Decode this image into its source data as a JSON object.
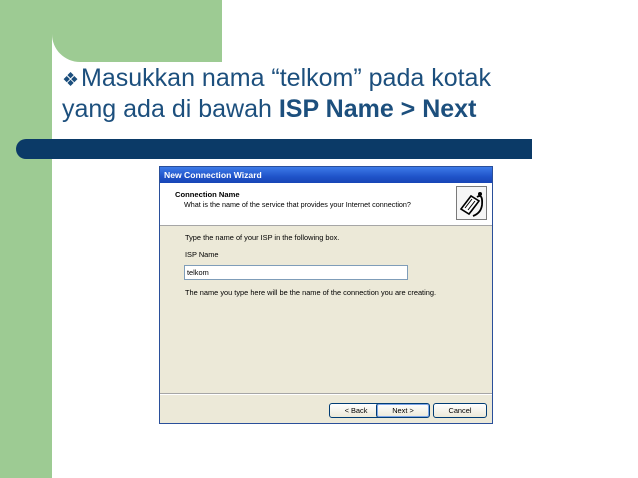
{
  "slide": {
    "bullet_icon": "diamond-bullet",
    "line1": "Masukkan nama “telkom” pada kotak",
    "line2_prefix": "yang ada di bawah ",
    "line2_bold": "ISP Name > Next",
    "colors": {
      "green": "#9dcb93",
      "navy": "#0b3a67",
      "text": "#1c4f7d"
    }
  },
  "dialog": {
    "title": "New Connection Wizard",
    "header_title": "Connection Name",
    "header_subtitle": "What is the name of the service that provides your Internet connection?",
    "header_icon": "network-cable-icon",
    "instruction": "Type the name of your ISP in the following box.",
    "isp_label": "ISP Name",
    "isp_value": "telkom",
    "note": "The name you type here will be the name of the connection you are creating.",
    "buttons": {
      "back": "< Back",
      "next": "Next >",
      "cancel": "Cancel"
    }
  }
}
